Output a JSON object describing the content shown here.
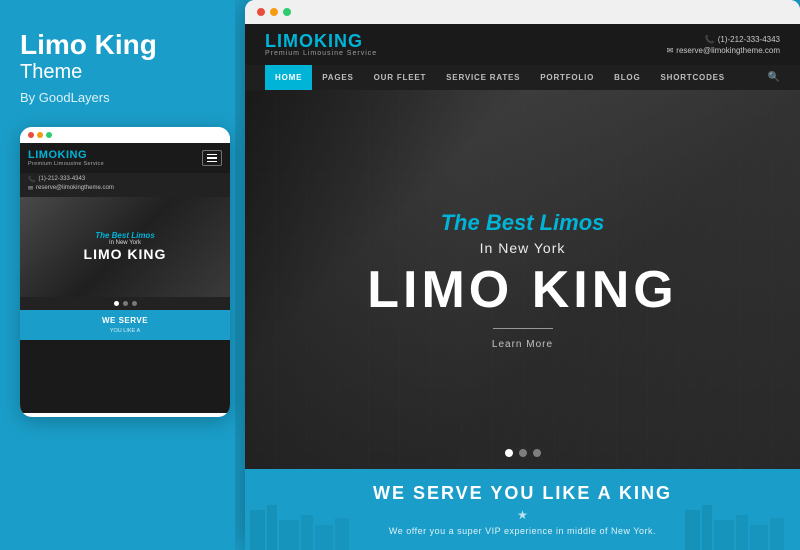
{
  "left": {
    "title_bold": "Limo King",
    "title_light": "Theme",
    "by": "By GoodLayers"
  },
  "mobile": {
    "logo": "LIMO",
    "logo_accent": "KING",
    "tagline": "Premium Limousine Service",
    "phone": "(1)-212-333-4343",
    "email": "reserve@limokingtheme.com",
    "hero": {
      "best_limos": "The Best Limos",
      "in_ny": "In New York",
      "limo_king": "LIMO KING"
    },
    "serve_title": "WE SERVE",
    "serve_sub": "YOU LIKE A"
  },
  "desktop": {
    "dots": {
      "d1_color": "#e74c3c",
      "d2_color": "#f39c12",
      "d3_color": "#2ecc71"
    },
    "header": {
      "logo": "LIMO",
      "logo_accent": "KING",
      "tagline": "Premium Limousine Service",
      "phone": "(1)-212-333-4343",
      "email": "reserve@limokingtheme.com"
    },
    "nav": [
      {
        "label": "HOME",
        "active": true
      },
      {
        "label": "PAGES",
        "active": false
      },
      {
        "label": "OUR FLEET",
        "active": false
      },
      {
        "label": "SERVICE RATES",
        "active": false
      },
      {
        "label": "PORTFOLIO",
        "active": false
      },
      {
        "label": "BLOG",
        "active": false
      },
      {
        "label": "SHORTCODES",
        "active": false
      }
    ],
    "hero": {
      "best_limos": "The Best Limos",
      "in_ny": "In New York",
      "limo_king": "LIMO KING",
      "learn_more": "Learn More"
    },
    "slider_dots": {
      "active_color": "#fff",
      "inactive_color": "rgba(255,255,255,0.4)"
    },
    "serve": {
      "title": "WE SERVE YOU LIKE A KING",
      "star": "★",
      "desc": "We offer you a super VIP experience in middle of New York."
    }
  },
  "accent_color": "#00b4d8",
  "bg_color": "#1a9ec9"
}
